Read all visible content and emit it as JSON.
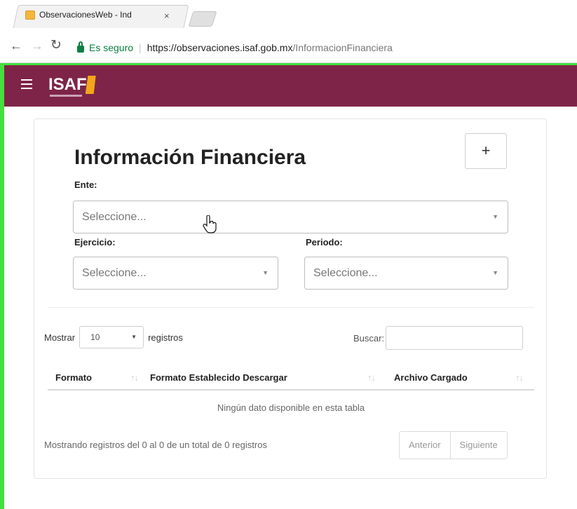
{
  "browser": {
    "tab_title": "ObservacionesWeb - Ind",
    "tab_close": "×",
    "secure_label": "Es seguro",
    "url_main": "https://observaciones.isaf.gob.mx",
    "url_path": "/InformacionFinanciera"
  },
  "header": {
    "logo_text": "ISAF",
    "logo_accent_color": "#f3a51a",
    "bar_color": "#7e2448"
  },
  "form": {
    "title": "Información Financiera",
    "add_label": "+",
    "ente_label": "Ente:",
    "ente_value": "Seleccione...",
    "ejercicio_label": "Ejercicio:",
    "ejercicio_value": "Seleccione...",
    "periodo_label": "Periodo:",
    "periodo_value": "Seleccione..."
  },
  "table": {
    "show_label": "Mostrar",
    "page_length": "10",
    "records_label": "registros",
    "search_label": "Buscar:",
    "columns": [
      "Formato",
      "Formato Establecido Descargar",
      "Archivo Cargado"
    ],
    "empty_message": "Ningún dato disponible en esta tabla",
    "info": "Mostrando registros del 0 al 0 de un total de 0 registros",
    "prev_label": "Anterior",
    "next_label": "Siguiente"
  }
}
